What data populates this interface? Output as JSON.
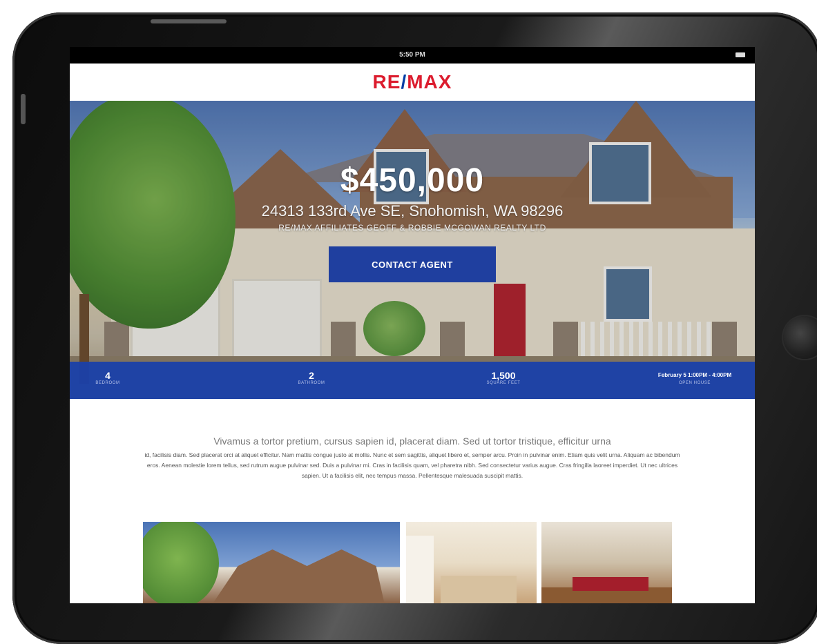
{
  "status_bar": {
    "time": "5:50 PM"
  },
  "brand": {
    "logo_prefix": "RE",
    "logo_slash": "/",
    "logo_suffix": "MAX",
    "accent": "#dc1c2e",
    "brand_blue": "#003da5"
  },
  "hero": {
    "price": "$450,000",
    "address": "24313 133rd Ave SE, Snohomish, WA 98296",
    "brokerage": "RE/MAX AFFILIATES GEOFF & ROBBIE MCGOWAN REALTY LTD",
    "cta_label": "CONTACT AGENT"
  },
  "stats": [
    {
      "value": "4",
      "label": "BEDROOM"
    },
    {
      "value": "2",
      "label": "BATHROOM"
    },
    {
      "value": "1,500",
      "label": "SQUARE FEET"
    },
    {
      "value": "February 5 1:00PM - 4:00PM",
      "label": "OPEN HOUSE"
    }
  ],
  "description": {
    "lead": "Vivamus a tortor pretium, cursus sapien id, placerat diam. Sed ut tortor tristique, efficitur urna",
    "body": "id, facilisis diam. Sed placerat orci at aliquet efficitur. Nam mattis congue justo at mollis. Nunc et sem sagittis, aliquet libero et, semper arcu. Proin in pulvinar enim. Etiam quis velit urna. Aliquam ac bibendum eros. Aenean molestie lorem tellus, sed rutrum augue pulvinar sed. Duis a pulvinar mi. Cras in facilisis quam, vel pharetra nibh. Sed consectetur varius augue. Cras fringilla laoreet imperdiet. Ut nec ultrices sapien. Ut a facilisis elit, nec tempus massa. Pellentesque malesuada suscipit mattis."
  },
  "gallery": {
    "images": [
      "house-exterior-photo",
      "kitchen-photo",
      "dining-room-photo"
    ]
  }
}
